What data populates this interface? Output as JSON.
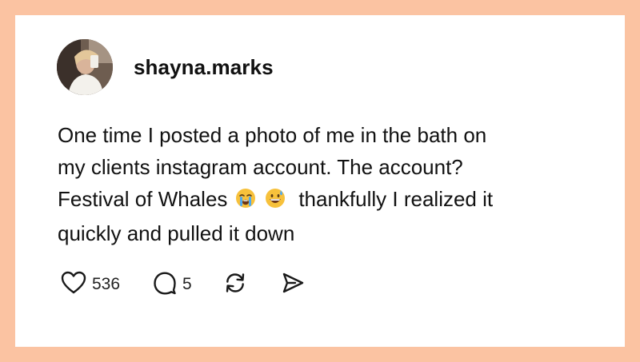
{
  "post": {
    "username": "shayna.marks",
    "text_lines": [
      "One time I posted a photo of me in the bath on",
      "my clients instagram account. The account?",
      "Festival of Whales",
      "thankfully I realized it",
      "quickly and pulled it down"
    ],
    "emojis": [
      "loudly-crying-face",
      "grinning-face-with-sweat"
    ],
    "likes": "536",
    "replies": "5"
  },
  "colors": {
    "frame_background": "#FBC3A2",
    "card_background": "#FFFFFF",
    "text": "#111111"
  },
  "icons": [
    "heart-icon",
    "comment-icon",
    "repost-icon",
    "share-icon"
  ]
}
